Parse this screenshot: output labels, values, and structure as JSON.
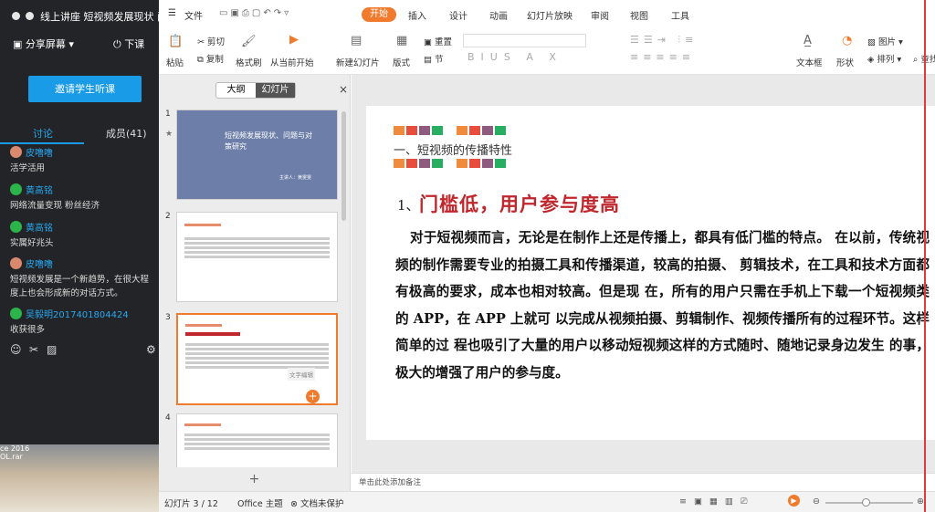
{
  "live_panel": {
    "title": "线上讲座 短视频发展现状 问题",
    "share_screen": "分享屏幕",
    "end_class": "下课",
    "invite_button": "邀请学生听课",
    "tabs": {
      "discussion": "讨论",
      "members": "成员(41)"
    },
    "messages": [
      {
        "name": "皮噜噜",
        "text": "活学活用"
      },
      {
        "name": "黄高铭",
        "text": "网络流量变现 粉丝经济"
      },
      {
        "name": "黄高铭",
        "text": "实属好兆头"
      },
      {
        "name": "皮噜噜",
        "text": "短视频发展是一个新趋势，在很大程度上也会形成新的对话方式。"
      },
      {
        "name": "吴毅明2017401804424",
        "text": "收获很多"
      }
    ]
  },
  "desktop": {
    "label1": "ce 2016",
    "label2": "OL.rar"
  },
  "menubar": {
    "file": "文件",
    "tabs": [
      "开始",
      "插入",
      "设计",
      "动画",
      "幻灯片放映",
      "审阅",
      "视图",
      "工具"
    ]
  },
  "ribbon": {
    "paste": "粘贴",
    "cut": "剪切",
    "copy": "复制",
    "format_painter": "格式刷",
    "from_current": "从当前开始",
    "new_slide": "新建幻灯片",
    "layout": "版式",
    "reset": "重置",
    "section": "节",
    "textbox": "文本框",
    "shape": "形状",
    "picture": "图片",
    "arrange": "排列",
    "find": "查找"
  },
  "pane": {
    "tab_outline": "大纲",
    "tab_slides": "幻灯片",
    "close": "×",
    "thumb1_title": "短视频发展现状、问题与对策研究",
    "thumb1_sub": "主讲人：黄雯雯",
    "thumb3_float": "文字编辑",
    "add": "+"
  },
  "slide": {
    "section_title": "一、短视频的传播特性",
    "heading_num": "1、",
    "heading": "门槛低，用户参与度高",
    "body": "对于短视频而言，无论是在制作上还是传播上，都具有低门槛的特点。 在以前，传统视频的制作需要专业的拍摄工具和传播渠道，较高的拍摄、 剪辑技术，在工具和技术方面都有极高的要求，成本也相对较高。但是现 在，所有的用户只需在手机上下载一个短视频类的 APP，在 APP 上就可 以完成从视频拍摄、剪辑制作、视频传播所有的过程环节。这样简单的过 程也吸引了大量的用户以移动短视频这样的方式随时、随地记录身边发生 的事，极大的增强了用户的参与度。"
  },
  "notes_placeholder": "单击此处添加备注",
  "status": {
    "slide_count": "幻灯片 3 / 12",
    "theme": "Office 主题",
    "protect": "文档未保护"
  },
  "colors": {
    "accent": "#f07b2c",
    "heading_red": "#c0272d",
    "invite_blue": "#1a9be8"
  }
}
